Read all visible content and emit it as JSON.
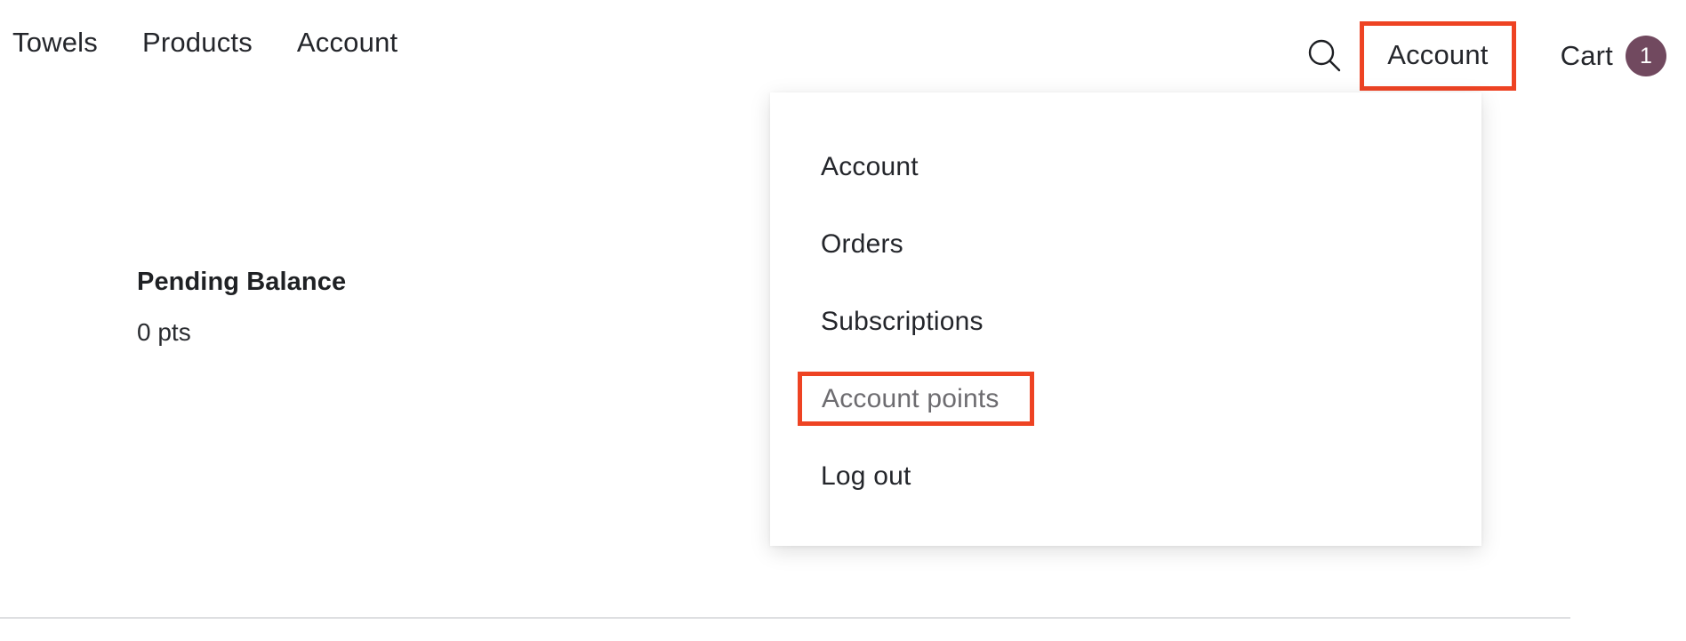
{
  "header": {
    "nav_links": [
      {
        "label": "Towels"
      },
      {
        "label": "Products"
      },
      {
        "label": "Account"
      }
    ],
    "search_icon": "search-icon",
    "account_button": {
      "label": "Account",
      "highlighted": true,
      "highlight_color": "#ee4323"
    },
    "cart": {
      "label": "Cart",
      "count": "1",
      "badge_color": "#71495f",
      "badge_text_color": "#ffffff"
    }
  },
  "main": {
    "balance": {
      "title": "Pending Balance",
      "value": "0 pts"
    }
  },
  "dropdown": {
    "visible": true,
    "items": [
      {
        "label": "Account",
        "highlighted": false
      },
      {
        "label": "Orders",
        "highlighted": false
      },
      {
        "label": "Subscriptions",
        "highlighted": false
      },
      {
        "label": "Account points",
        "highlighted": true
      },
      {
        "label": "Log out",
        "highlighted": false
      }
    ]
  },
  "colors": {
    "text": "#24262b",
    "muted_text": "#6d6c70",
    "highlight": "#ee4323",
    "accent_purple": "#71495f",
    "divider": "#dedfe1",
    "background": "#ffffff"
  }
}
